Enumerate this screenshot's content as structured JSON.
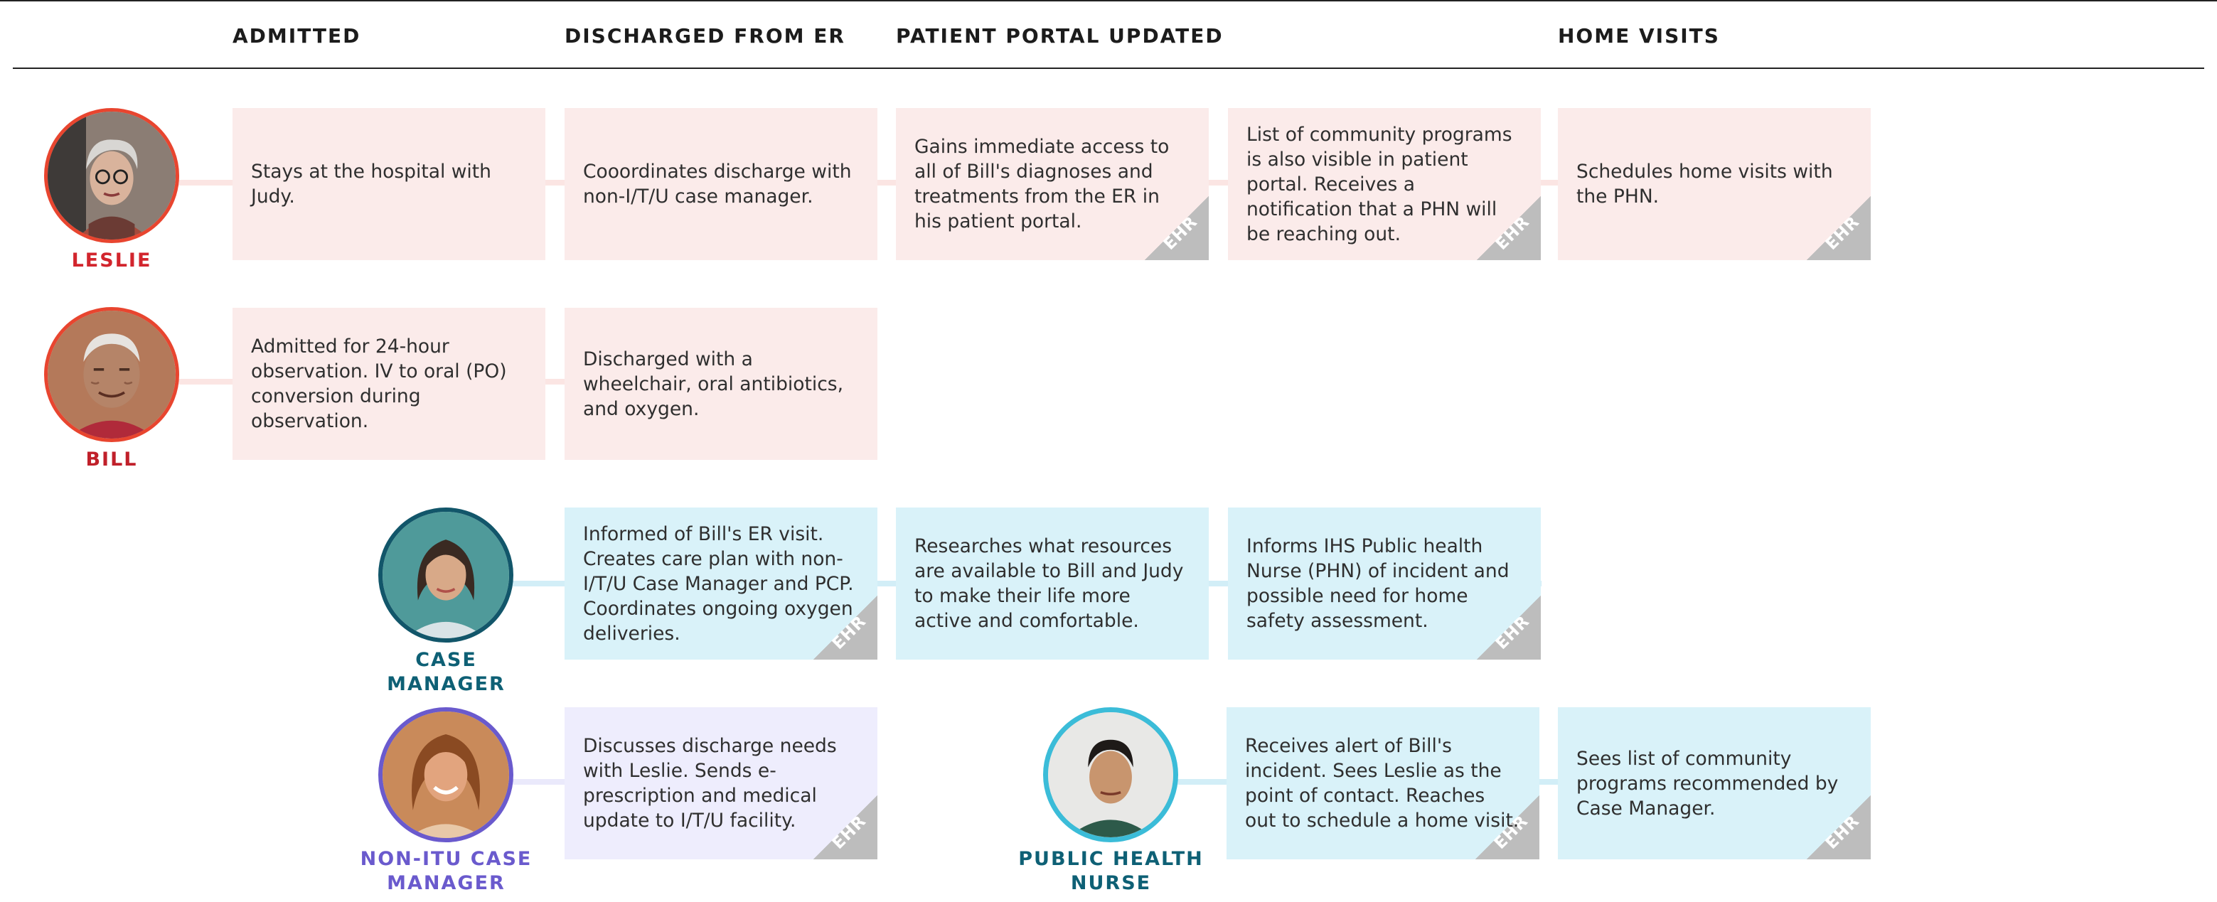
{
  "columns": [
    "ADMITTED",
    "DISCHARGED FROM ER",
    "PATIENT PORTAL UPDATED",
    "HOME VISITS"
  ],
  "ehr_label": "EHR",
  "colors": {
    "leslie": "#d2252d",
    "bill": "#c0202a",
    "case_manager": "#0e6075",
    "non_itu": "#6a5acd",
    "public_health_nurse": "#0e6075",
    "pink_card": "#fbebea",
    "blue_card": "#d9f2f9",
    "lavender_card": "#eeedfd"
  },
  "people": {
    "leslie": {
      "name": "LESLIE",
      "cards": {
        "admitted": "Stays at the hospital with Judy.",
        "discharged": "Cooordinates discharge with non-I/T/U case manager.",
        "portal": "Gains immediate access to all of Bill's diagnoses and treatments from the ER in his patient portal.",
        "portal_2": "List of community programs is also visible in patient portal. Receives a notification that a PHN will be reaching out.",
        "home_visits": "Schedules home visits with the PHN."
      }
    },
    "bill": {
      "name": "BILL",
      "cards": {
        "admitted": "Admitted for 24-hour observation. IV to oral (PO) conversion during observation.",
        "discharged": "Discharged with a wheelchair, oral antibiotics, and oxygen."
      }
    },
    "case_manager": {
      "name": "CASE MANAGER",
      "cards": {
        "discharged": "Informed of Bill's ER visit. Creates care plan with non-I/T/U Case Manager and PCP. Coordinates ongoing oxygen deliveries.",
        "portal": "Researches what resources are available to Bill and Judy to make their life more active and comfortable.",
        "portal_2": "Informs IHS Public health Nurse (PHN) of incident and possible need for home safety assessment."
      }
    },
    "non_itu": {
      "name_line1": "NON-ITU CASE",
      "name_line2": "MANAGER",
      "cards": {
        "discharged": "Discusses discharge needs with Leslie. Sends e-prescription and medical update to I/T/U facility."
      }
    },
    "public_health_nurse": {
      "name_line1": "PUBLIC HEALTH",
      "name_line2": "NURSE",
      "cards": {
        "portal_2": "Receives alert of Bill's incident. Sees Leslie as the point of contact. Reaches out to schedule a home visit.",
        "home_visits": "Sees list of community programs recommended by Case Manager."
      }
    }
  }
}
